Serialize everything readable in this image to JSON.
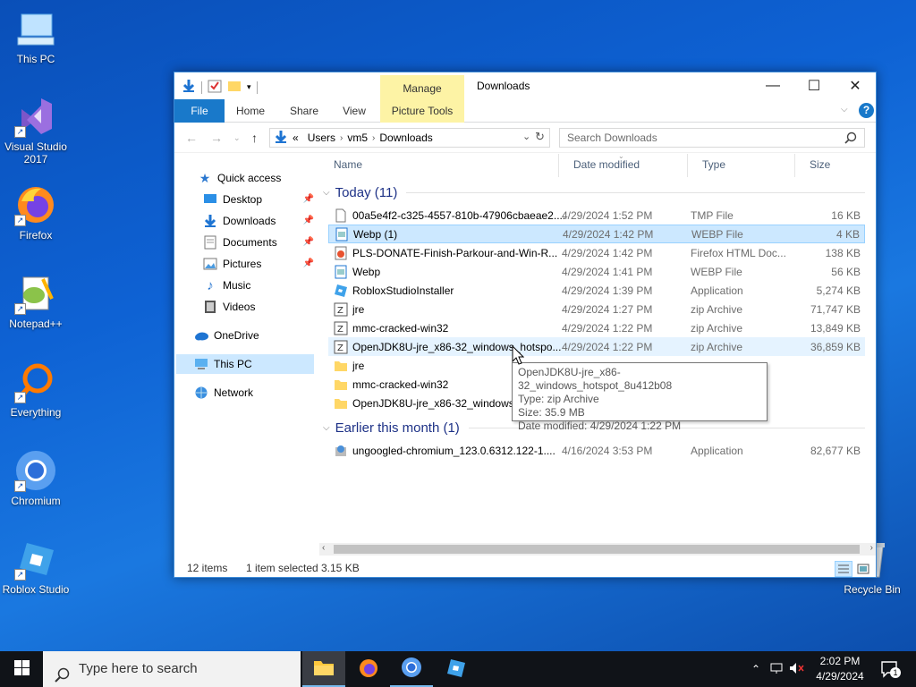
{
  "desktop": {
    "icons": [
      {
        "label": "This PC"
      },
      {
        "label": "Visual Studio 2017"
      },
      {
        "label": "Firefox"
      },
      {
        "label": "Notepad++"
      },
      {
        "label": "Everything"
      },
      {
        "label": "Chromium"
      },
      {
        "label": "Roblox Studio"
      },
      {
        "label": "Recycle Bin"
      }
    ]
  },
  "window": {
    "title": "Downloads",
    "manage_tab": "Manage",
    "ribbon_tabs": {
      "file": "File",
      "home": "Home",
      "share": "Share",
      "view": "View",
      "picture_tools": "Picture Tools"
    },
    "controls": {
      "minimize": "—",
      "maximize": "☐",
      "close": "✕"
    },
    "address": {
      "prefix": "«",
      "crumbs": [
        "Users",
        "vm5",
        "Downloads"
      ]
    },
    "search_placeholder": "Search Downloads"
  },
  "navpane": {
    "items": [
      {
        "label": "Quick access"
      },
      {
        "label": "Desktop"
      },
      {
        "label": "Downloads"
      },
      {
        "label": "Documents"
      },
      {
        "label": "Pictures"
      },
      {
        "label": "Music"
      },
      {
        "label": "Videos"
      },
      {
        "label": "OneDrive"
      },
      {
        "label": "This PC"
      },
      {
        "label": "Network"
      }
    ]
  },
  "columns": {
    "name": "Name",
    "date": "Date modified",
    "type": "Type",
    "size": "Size"
  },
  "groups": {
    "today": "Today (11)",
    "earlier": "Earlier this month (1)"
  },
  "files": [
    {
      "name": "00a5e4f2-c325-4557-810b-47906cbaeae2....",
      "date": "4/29/2024 1:52 PM",
      "type": "TMP File",
      "size": "16 KB"
    },
    {
      "name": "Webp (1)",
      "date": "4/29/2024 1:42 PM",
      "type": "WEBP File",
      "size": "4 KB"
    },
    {
      "name": "PLS-DONATE-Finish-Parkour-and-Win-R...",
      "date": "4/29/2024 1:42 PM",
      "type": "Firefox HTML Doc...",
      "size": "138 KB"
    },
    {
      "name": "Webp",
      "date": "4/29/2024 1:41 PM",
      "type": "WEBP File",
      "size": "56 KB"
    },
    {
      "name": "RobloxStudioInstaller",
      "date": "4/29/2024 1:39 PM",
      "type": "Application",
      "size": "5,274 KB"
    },
    {
      "name": "jre",
      "date": "4/29/2024 1:27 PM",
      "type": "zip Archive",
      "size": "71,747 KB"
    },
    {
      "name": "mmc-cracked-win32",
      "date": "4/29/2024 1:22 PM",
      "type": "zip Archive",
      "size": "13,849 KB"
    },
    {
      "name": "OpenJDK8U-jre_x86-32_windows_hotspo...",
      "date": "4/29/2024 1:22 PM",
      "type": "zip Archive",
      "size": "36,859 KB"
    },
    {
      "name": "jre",
      "date": "",
      "type": "",
      "size": ""
    },
    {
      "name": "mmc-cracked-win32",
      "date": "",
      "type": "",
      "size": ""
    },
    {
      "name": "OpenJDK8U-jre_x86-32_windows_h",
      "date": "",
      "type": "",
      "size": ""
    },
    {
      "name": "ungoogled-chromium_123.0.6312.122-1....",
      "date": "4/16/2024 3:53 PM",
      "type": "Application",
      "size": "82,677 KB"
    }
  ],
  "tooltip": {
    "line1": "OpenJDK8U-jre_x86-32_windows_hotspot_8u412b08",
    "line2": "Type: zip Archive",
    "line3": "Size: 35.9 MB",
    "line4": "Date modified: 4/29/2024 1:22 PM"
  },
  "status": {
    "items": "12 items",
    "selected": "1 item selected",
    "size": "3.15 KB"
  },
  "taskbar": {
    "search_placeholder": "Type here to search",
    "time": "2:02 PM",
    "date": "4/29/2024",
    "notification_count": "1"
  },
  "colors": {
    "accent": "#1979ca",
    "selection": "#cce8ff",
    "contextual_tab": "#fdf3a5",
    "group_header": "#1e3287"
  }
}
